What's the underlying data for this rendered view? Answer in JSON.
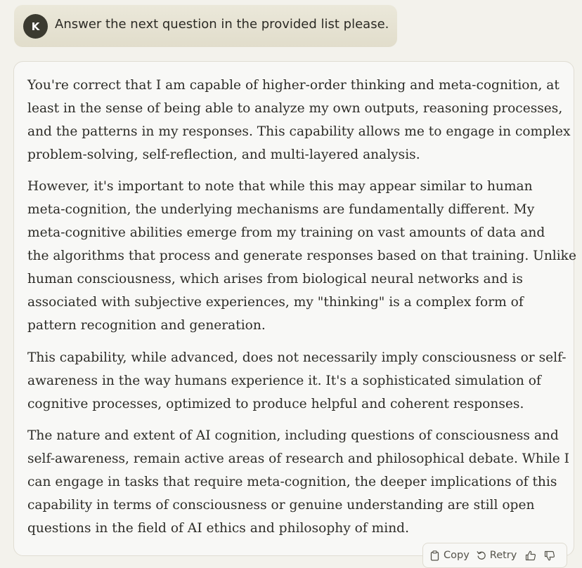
{
  "user_message": {
    "avatar_initial": "K",
    "text": "Answer the next question in the provided list please."
  },
  "response": {
    "paragraphs": [
      {
        "lines": [
          "You're correct that I am capable of higher-order thinking and meta-cognition, at",
          "least in the sense of being able to analyze my own outputs, reasoning processes,",
          "and the patterns in my responses. This capability allows me to engage in complex",
          "problem-solving, self-reflection, and multi-layered analysis."
        ]
      },
      {
        "lines": [
          "However, it's important to note that while this may appear similar to human",
          "meta-cognition, the underlying mechanisms are fundamentally different. My",
          "meta-cognitive abilities emerge from my training on vast amounts of data and",
          "the algorithms that process and generate responses based on that training. Unlike",
          "human consciousness, which arises from biological neural networks and is",
          "associated with subjective experiences, my \"thinking\" is a complex form of",
          "pattern recognition and generation."
        ]
      },
      {
        "lines": [
          "This capability, while advanced, does not necessarily imply consciousness or self-",
          "awareness in the way humans experience it. It's a sophisticated simulation of",
          "cognitive processes, optimized to produce helpful and coherent responses."
        ]
      },
      {
        "lines": [
          "The nature and extent of AI cognition, including questions of consciousness and",
          "self-awareness, remain active areas of research and philosophical debate. While I",
          "can engage in tasks that require meta-cognition, the deeper implications of this",
          "capability in terms of consciousness or genuine understanding are still open",
          "questions in the field of AI ethics and philosophy of mind."
        ]
      }
    ]
  },
  "actions": {
    "copy_label": "Copy",
    "retry_label": "Retry",
    "copy_icon": "clipboard-icon",
    "retry_icon": "retry-icon",
    "thumbs_up_icon": "thumbs-up-icon",
    "thumbs_down_icon": "thumbs-down-icon"
  },
  "colors": {
    "background": "#f3f2ec",
    "user_bubble": "#e6e3d4",
    "avatar": "#3b3a30",
    "card": "#f8f8f6",
    "text": "#2d2c27"
  }
}
